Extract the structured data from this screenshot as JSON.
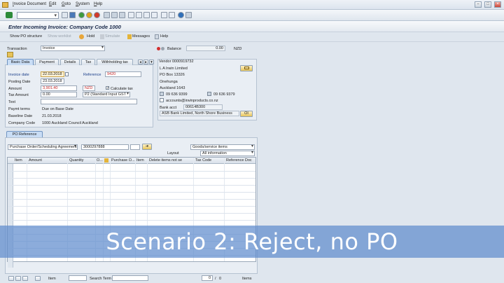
{
  "menu": {
    "items": [
      "Invoice Document",
      "Edit",
      "Goto",
      "System",
      "Help"
    ]
  },
  "title": "Enter Incoming Invoice: Company Code 1000",
  "app_toolbar": {
    "show_po_structure": "Show PO structure",
    "show_worklist": "Show worklist",
    "hold": "Hold",
    "simulate": "Simulate",
    "messages": "Messages",
    "help": "Help"
  },
  "transaction": {
    "label": "Transaction",
    "value": "Invoice"
  },
  "balance": {
    "label": "Balance",
    "value": "0.00",
    "currency": "NZD"
  },
  "tabs": [
    "Basic Data",
    "Payment",
    "Details",
    "Tax",
    "Withholding tax"
  ],
  "basic_data": {
    "invoice_date_label": "Invoice date",
    "invoice_date": "22.03.2018",
    "reference_label": "Reference",
    "reference": "9420",
    "posting_date_label": "Posting Date",
    "posting_date": "23.03.2018",
    "amount_label": "Amount",
    "amount": "3,901.40",
    "amount_currency": "NZD",
    "calculate_tax_label": "Calculate tax",
    "tax_amount_label": "Tax Amount",
    "tax_amount": "0.00",
    "tax_code": "P2 (Standard Input GST ...",
    "text_label": "Text",
    "text": "",
    "payment_terms_label": "Paymt terms",
    "payment_terms": "Due on Base Date",
    "baseline_date_label": "Baseline Date",
    "baseline_date": "21.03.2018",
    "company_code_label": "Company Code",
    "company_code": "1000 Auckland Council Auckland"
  },
  "vendor": {
    "header": "Vendor 0000919732",
    "name": "L A Irwin Limited",
    "address1": "PO Box 13326",
    "address2": "Onehunga",
    "address3": "Auckland 1643",
    "phone": "09 636 9399",
    "fax": "09 636 9379",
    "email": "accounts@irwinproducts.co.nz",
    "bank_acct_label": "Bank acct",
    "bank_acct": "00614B300",
    "bank_name": "ASB Bank Limited, North Shore Business",
    "bank_btn": "OI"
  },
  "po_reference": {
    "tab": "PO Reference",
    "doc_type": "Purchase Order/Scheduling Agreement",
    "po_number": "3000297888",
    "items_type": "Goods/service items",
    "layout_label": "Layout",
    "layout_value": "All information",
    "columns": [
      "Item",
      "Amount",
      "Quantity",
      "O...",
      "",
      "Purchase O...",
      "Item",
      "Delete items not se",
      "Tax Code",
      "Reference Doc"
    ]
  },
  "overlay_caption": "Scenario 2: Reject, no PO",
  "footer": {
    "item_label": "Item",
    "search_label": "Search Term",
    "page_current": "0",
    "page_total": "0",
    "items_label": "Items"
  }
}
